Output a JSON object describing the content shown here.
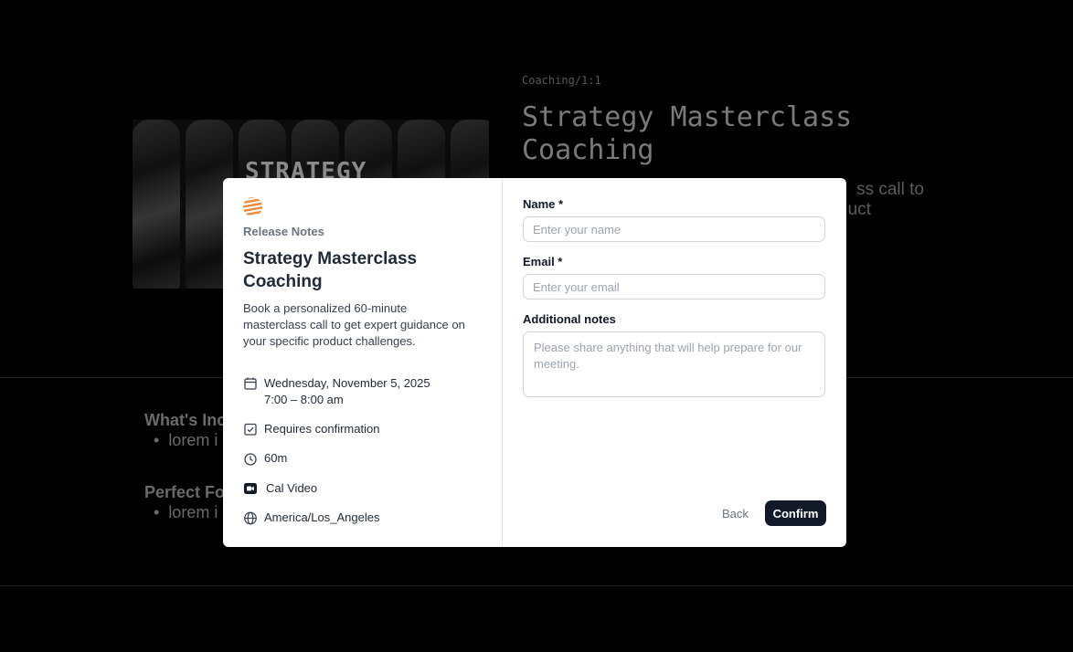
{
  "background": {
    "hero_text": "STRATEGY",
    "breadcrumb": "Coaching/1:1",
    "title": "Strategy Masterclass Coaching",
    "desc_line1": "ss call to",
    "desc_line2": "uct",
    "section1_title": "What's Inc",
    "section1_bullet": "lorem i",
    "section2_title": "Perfect Fo",
    "section2_bullet": "lorem i"
  },
  "modal": {
    "org_name": "Release Notes",
    "event_title": "Strategy Masterclass Coaching",
    "event_description": "Book a personalized 60-minute masterclass call to get expert guidance on your specific product challenges.",
    "details": {
      "date": "Wednesday, November 5, 2025",
      "time": "7:00 – 8:00 am",
      "confirmation": "Requires confirmation",
      "duration": "60m",
      "location": "Cal Video",
      "timezone": "America/Los_Angeles"
    },
    "form": {
      "name_label": "Name *",
      "name_placeholder": "Enter your name",
      "email_label": "Email *",
      "email_placeholder": "Enter your email",
      "notes_label": "Additional notes",
      "notes_placeholder": "Please share anything that will help prepare for our meeting."
    },
    "back_label": "Back",
    "confirm_label": "Confirm"
  },
  "colors": {
    "logo_accent": "#f08c3c",
    "confirm_bg": "#111827"
  }
}
